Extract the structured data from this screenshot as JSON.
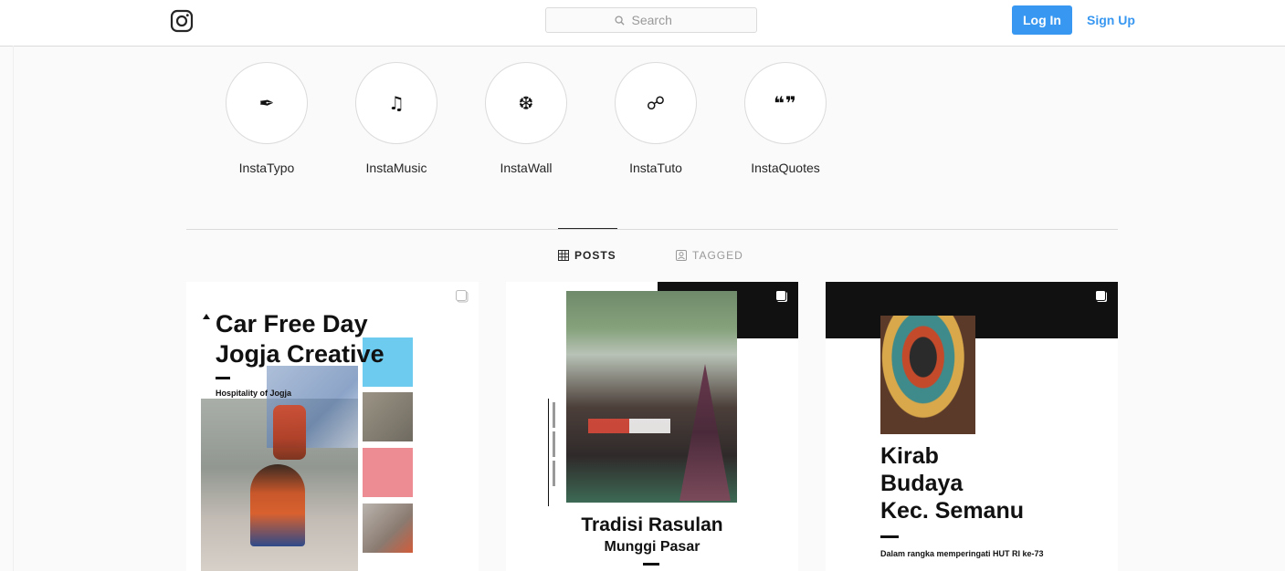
{
  "header": {
    "search_placeholder": "Search",
    "login_label": "Log In",
    "signup_label": "Sign Up",
    "logo_icon": "instagram-icon"
  },
  "highlights": [
    {
      "label": "InstaTypo",
      "icon": "pen-nib-icon",
      "glyph": "✒"
    },
    {
      "label": "InstaMusic",
      "icon": "music-note-icon",
      "glyph": "♫"
    },
    {
      "label": "InstaWall",
      "icon": "snowflake-icon",
      "glyph": "❆"
    },
    {
      "label": "InstaTuto",
      "icon": "link-icon",
      "glyph": "☍"
    },
    {
      "label": "InstaQuotes",
      "icon": "quote-icon",
      "glyph": "❝❞"
    }
  ],
  "tabs": [
    {
      "label": "POSTS",
      "icon": "grid-icon",
      "active": true
    },
    {
      "label": "TAGGED",
      "icon": "tag-person-icon",
      "active": false
    }
  ],
  "posts": [
    {
      "title_line1": "Car Free Day",
      "title_line2": "Jogja Creative",
      "subtitle": "Hospitality of Jogja",
      "icon": "multiple-posts-icon"
    },
    {
      "title": "Tradisi Rasulan",
      "subtitle": "Munggi Pasar",
      "icon": "multiple-posts-icon"
    },
    {
      "title_line1": "Kirab",
      "title_line2": "Budaya",
      "title_line3": "Kec. Semanu",
      "subtitle": "Dalam rangka memperingati HUT RI ke-73",
      "icon": "multiple-posts-icon"
    }
  ],
  "colors": {
    "accent": "#3897f0",
    "border": "#dbdbdb",
    "background": "#fafafa"
  }
}
